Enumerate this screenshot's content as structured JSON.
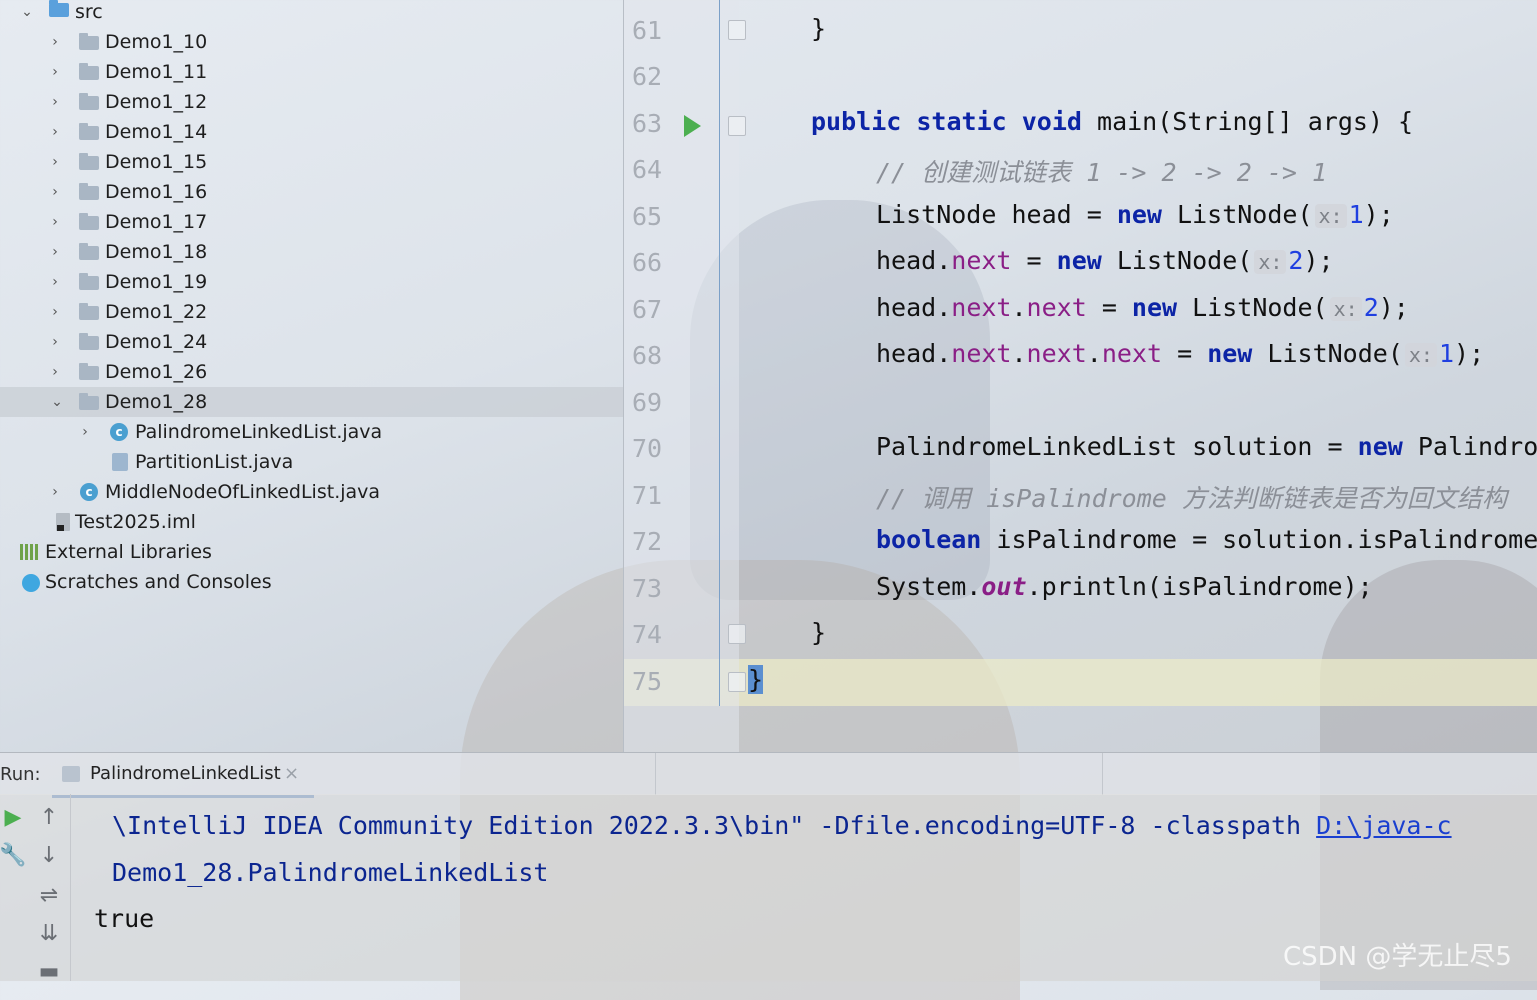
{
  "project": {
    "root_label": "src",
    "folders": [
      "Demo1_10",
      "Demo1_11",
      "Demo1_12",
      "Demo1_14",
      "Demo1_15",
      "Demo1_16",
      "Demo1_17",
      "Demo1_18",
      "Demo1_19",
      "Demo1_22",
      "Demo1_24",
      "Demo1_26",
      "Demo1_28"
    ],
    "files_in_demo1_28": [
      "PalindromeLinkedList.java",
      "PartitionList.java"
    ],
    "middle_file": "MiddleNodeOfLinkedList.java",
    "iml_file": "Test2025.iml",
    "external_libraries": "External Libraries",
    "scratches": "Scratches and Consoles"
  },
  "editor": {
    "line_numbers": [
      "61",
      "62",
      "63",
      "64",
      "65",
      "66",
      "67",
      "68",
      "69",
      "70",
      "71",
      "72",
      "73",
      "74",
      "75"
    ],
    "lines": {
      "l61": "}",
      "l63_kw1": "public",
      "l63_kw2": "static",
      "l63_kw3": "void",
      "l63_rest": "main(String[] args) {",
      "l64": "// 创建测试链表 1 -> 2 -> 2 -> 1",
      "l65_a": "ListNode head = ",
      "l65_new": "new",
      "l65_b": " ListNode(",
      "l65_hint": "x:",
      "l65_num": "1",
      "l65_c": ");",
      "l66_a": "head.",
      "l66_f1": "next",
      "l66_b": " = ",
      "l66_new": "new",
      "l66_c": " ListNode(",
      "l66_hint": "x:",
      "l66_num": "2",
      "l66_d": ");",
      "l67_a": "head.",
      "l67_f1": "next",
      "l67_dot": ".",
      "l67_f2": "next",
      "l67_b": " = ",
      "l67_new": "new",
      "l67_c": " ListNode(",
      "l67_hint": "x:",
      "l67_num": "2",
      "l67_d": ");",
      "l68_a": "head.",
      "l68_f1": "next",
      "l68_dot1": ".",
      "l68_f2": "next",
      "l68_dot2": ".",
      "l68_f3": "next",
      "l68_b": " = ",
      "l68_new": "new",
      "l68_c": " ListNode(",
      "l68_hint": "x:",
      "l68_num": "1",
      "l68_d": ");",
      "l70_a": "PalindromeLinkedList solution = ",
      "l70_new": "new",
      "l70_b": " PalindromeLinkedList();",
      "l71": "// 调用 isPalindrome 方法判断链表是否为回文结构",
      "l72_kw": "boolean",
      "l72_rest": " isPalindrome = solution.isPalindrome(head);",
      "l73_a": "System.",
      "l73_out": "out",
      "l73_b": ".println(isPalindrome);",
      "l74": "}",
      "l75": "}"
    }
  },
  "run": {
    "label": "Run:",
    "tab_label": "PalindromeLinkedList",
    "close": "×",
    "console": {
      "line1_text": "\\IntelliJ IDEA Community Edition 2022.3.3\\bin\" -Dfile.encoding=UTF-8 -classpath ",
      "line1_link": "D:\\java-c",
      "line2": "Demo1_28.PalindromeLinkedList",
      "line3": "true"
    }
  },
  "watermark": "CSDN @学无止尽5"
}
